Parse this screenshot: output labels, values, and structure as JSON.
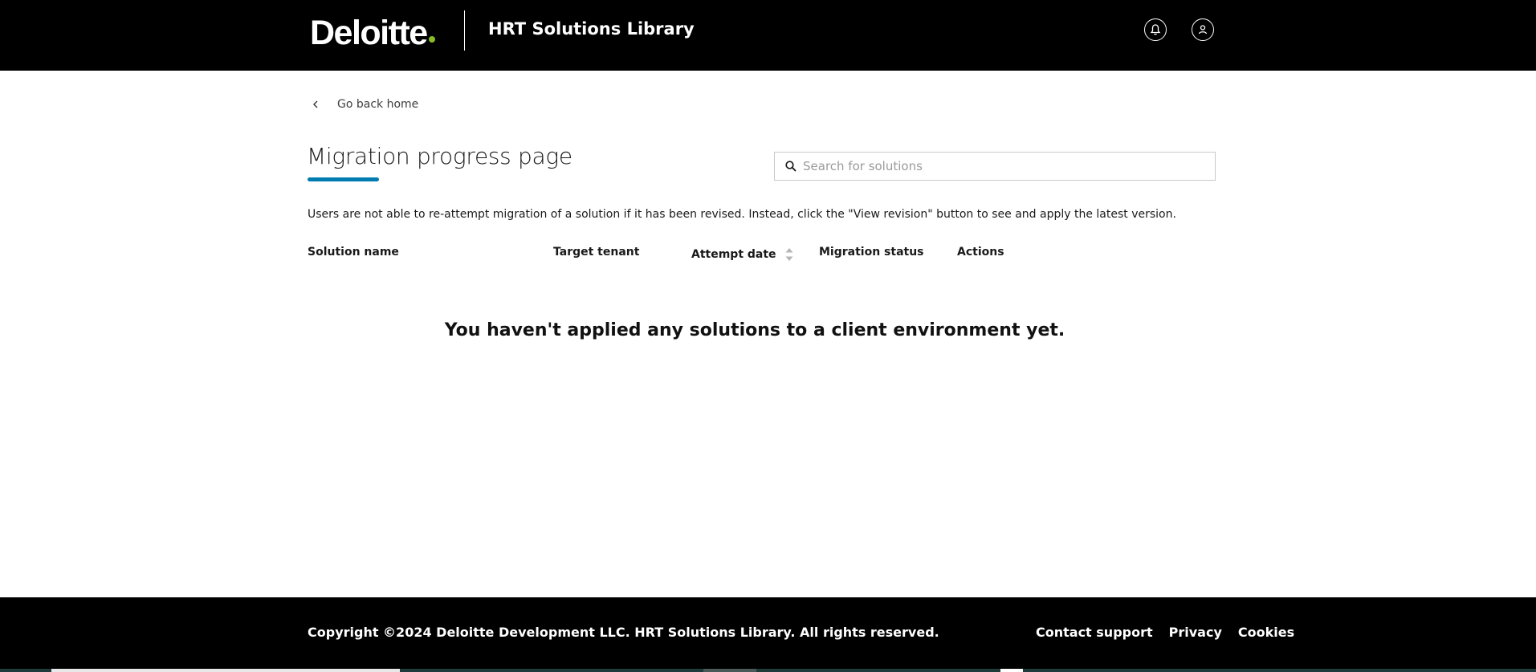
{
  "header": {
    "brand": "Deloitte",
    "app_title": "HRT Solutions Library",
    "icons": [
      "bell-icon",
      "user-icon"
    ],
    "brand_dot_color": "#86BC25"
  },
  "nav": {
    "back_label": "Go back home"
  },
  "page": {
    "title": "Migration progress page",
    "accent_color": "#007CB0",
    "search_placeholder": "Search for solutions",
    "search_value": "",
    "notice": "Users are not able to re-attempt migration of a solution if it has been revised. Instead, click the \"View revision\" button to see and apply the latest version."
  },
  "table": {
    "columns": [
      "Solution name",
      "Target tenant",
      "Attempt date",
      "Migration status",
      "Actions"
    ],
    "rows": [],
    "empty_message": "You haven't applied any solutions to a client environment yet."
  },
  "footer": {
    "copyright": "Copyright ©2024 Deloitte Development LLC. HRT Solutions Library. All rights reserved.",
    "links": [
      "Contact support",
      "Privacy",
      "Cookies"
    ]
  }
}
